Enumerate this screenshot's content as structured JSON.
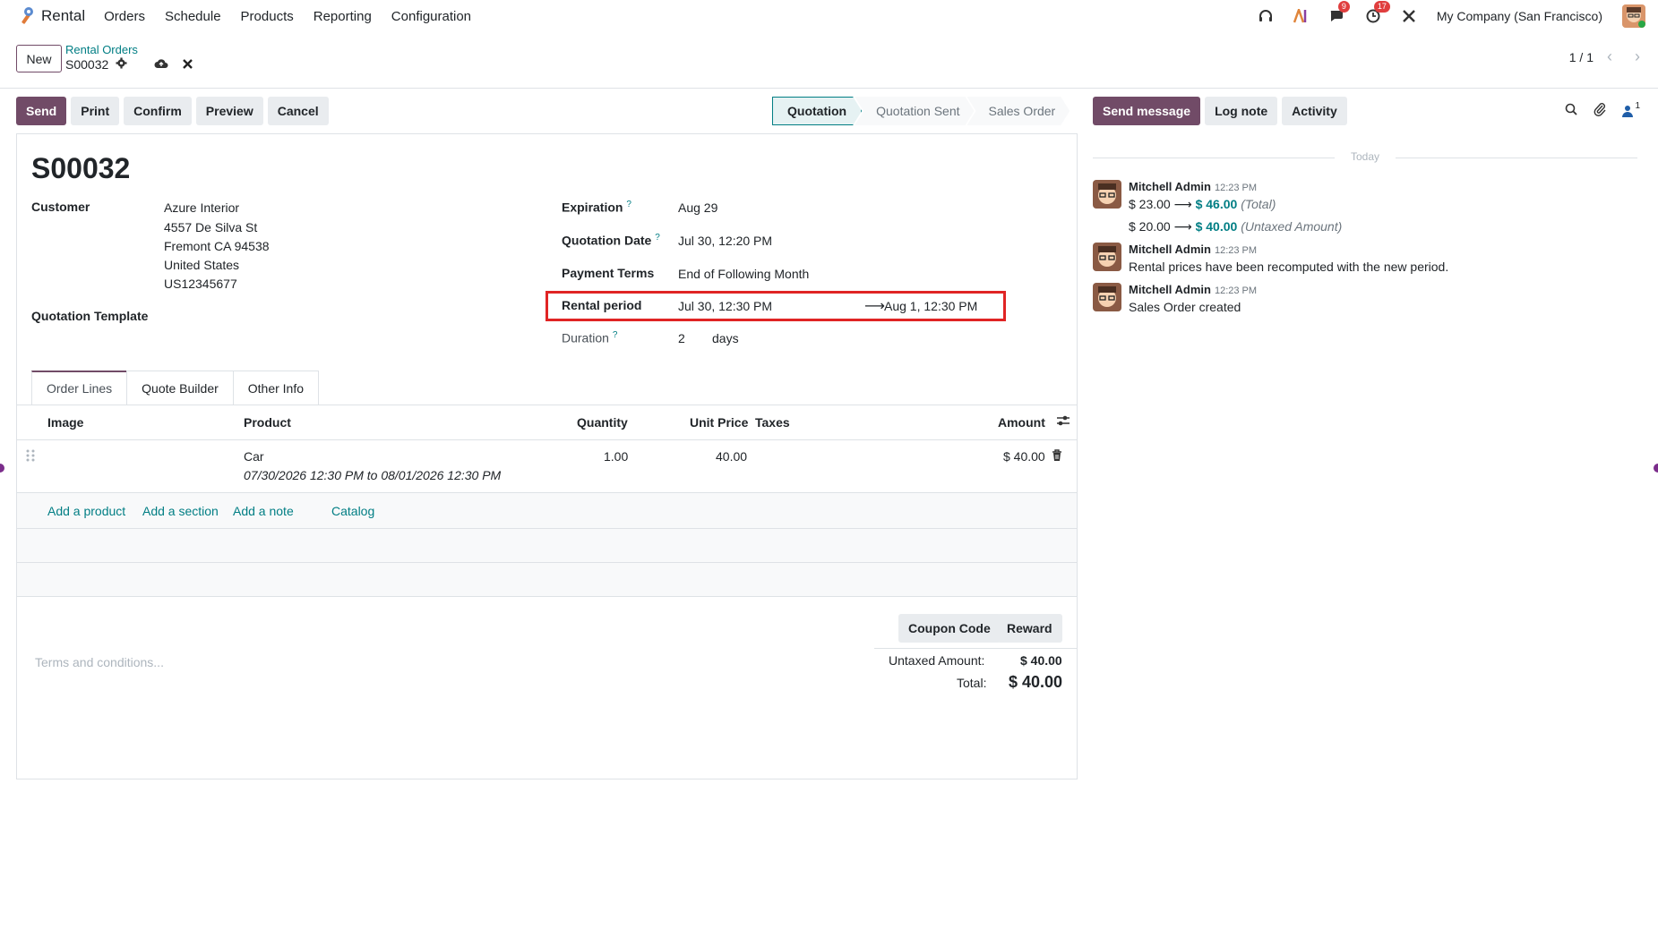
{
  "navbar": {
    "app_name": "Rental",
    "menu": [
      "Orders",
      "Schedule",
      "Products",
      "Reporting",
      "Configuration"
    ],
    "chat_badge": "9",
    "activity_badge": "17",
    "company": "My Company (San Francisco)"
  },
  "control": {
    "new_label": "New",
    "breadcrumb": "Rental Orders",
    "record_name": "S00032",
    "pager": "1 / 1"
  },
  "actions": [
    "Send",
    "Print",
    "Confirm",
    "Preview",
    "Cancel"
  ],
  "statusbar": [
    "Quotation",
    "Quotation Sent",
    "Sales Order"
  ],
  "form": {
    "title": "S00032",
    "customer_label": "Customer",
    "customer_lines": [
      "Azure Interior",
      "4557 De Silva St",
      "Fremont CA 94538",
      "United States",
      "US12345677"
    ],
    "template_label": "Quotation Template",
    "expiration_label": "Expiration",
    "expiration_value": "Aug 29",
    "quotation_date_label": "Quotation Date",
    "quotation_date_value": "Jul 30, 12:20 PM",
    "payment_terms_label": "Payment Terms",
    "payment_terms_value": "End of Following Month",
    "rental_period_label": "Rental period",
    "rental_start": "Jul 30, 12:30 PM",
    "rental_end": "Aug 1, 12:30 PM",
    "duration_label": "Duration",
    "duration_value": "2",
    "duration_unit": "days"
  },
  "tabs": [
    "Order Lines",
    "Quote Builder",
    "Other Info"
  ],
  "table": {
    "headers": {
      "image": "Image",
      "product": "Product",
      "quantity": "Quantity",
      "unit_price": "Unit Price",
      "taxes": "Taxes",
      "amount": "Amount"
    },
    "rows": [
      {
        "product": "Car",
        "description": "07/30/2026 12:30 PM to 08/01/2026 12:30 PM",
        "quantity": "1.00",
        "unit_price": "40.00",
        "amount": "$ 40.00"
      }
    ],
    "add_links": [
      "Add a product",
      "Add a section",
      "Add a note",
      "Catalog"
    ]
  },
  "totals": {
    "coupon_label": "Coupon Code",
    "reward_label": "Reward",
    "terms_placeholder": "Terms and conditions...",
    "untaxed_label": "Untaxed Amount:",
    "untaxed_value": "$ 40.00",
    "total_label": "Total:",
    "total_value": "$ 40.00"
  },
  "chatter": {
    "buttons": [
      "Send message",
      "Log note",
      "Activity"
    ],
    "followers_count": "1",
    "date_separator": "Today",
    "messages": [
      {
        "author": "Mitchell Admin",
        "time": "12:23 PM",
        "line1_old": "$ 23.00",
        "line1_new": "$ 46.00",
        "line1_field": "(Total)",
        "line2_old": "$ 20.00",
        "line2_new": "$ 40.00",
        "line2_field": "(Untaxed Amount)"
      },
      {
        "author": "Mitchell Admin",
        "time": "12:23 PM",
        "body": "Rental prices have been recomputed with the new period."
      },
      {
        "author": "Mitchell Admin",
        "time": "12:23 PM",
        "body": "Sales Order created"
      }
    ]
  },
  "colors": {
    "primary": "#714b67",
    "link": "#017e84",
    "highlight": "#e02424"
  }
}
